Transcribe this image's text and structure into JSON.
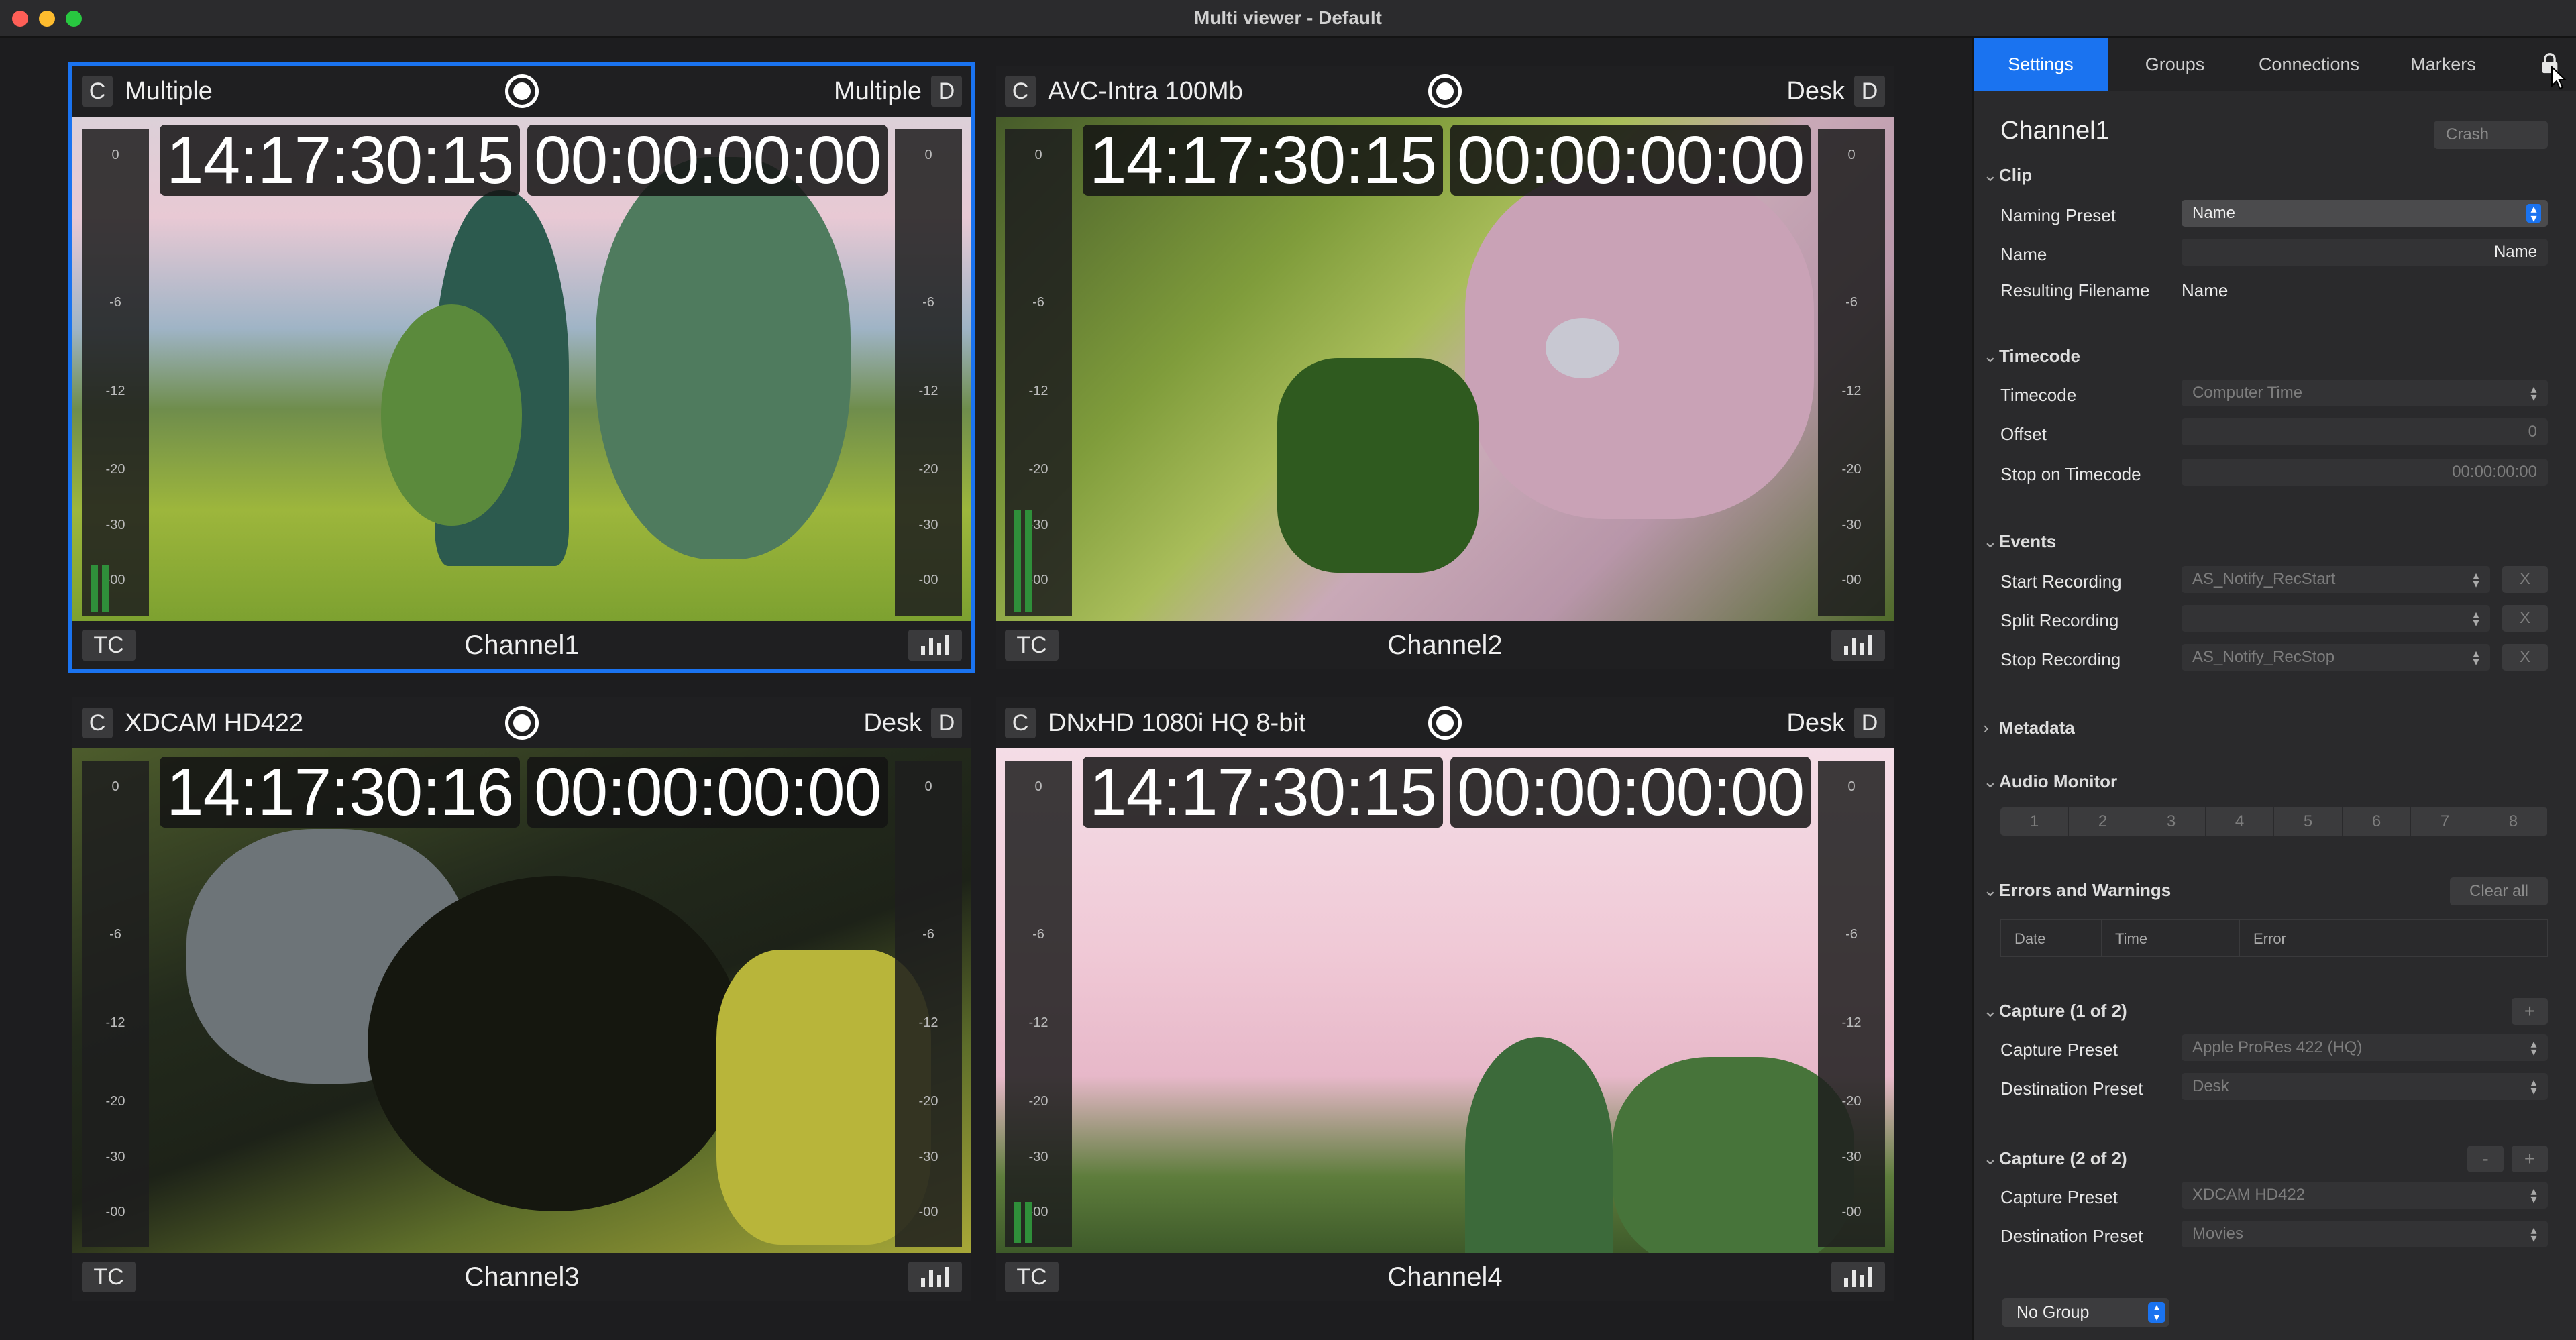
{
  "window": {
    "title": "Multi viewer - Default"
  },
  "tiles": [
    {
      "channel": "Channel1",
      "c_label": "C",
      "source": "Multiple",
      "dest": "Multiple",
      "d_label": "D",
      "tc_label": "TC",
      "time": "14:17:30:15",
      "timecode": "00:00:00:00",
      "selected": true
    },
    {
      "channel": "Channel2",
      "c_label": "C",
      "source": "AVC-Intra 100Mb",
      "dest": "Desk",
      "d_label": "D",
      "tc_label": "TC",
      "time": "14:17:30:15",
      "timecode": "00:00:00:00",
      "selected": false
    },
    {
      "channel": "Channel3",
      "c_label": "C",
      "source": "XDCAM HD422",
      "dest": "Desk",
      "d_label": "D",
      "tc_label": "TC",
      "time": "14:17:30:16",
      "timecode": "00:00:00:00",
      "selected": false
    },
    {
      "channel": "Channel4",
      "c_label": "C",
      "source": "DNxHD 1080i HQ 8-bit",
      "dest": "Desk",
      "d_label": "D",
      "tc_label": "TC",
      "time": "14:17:30:15",
      "timecode": "00:00:00:00",
      "selected": false
    }
  ],
  "meter_scale": [
    "0",
    "-6",
    "-12",
    "-20",
    "-30",
    "-00"
  ],
  "panel": {
    "tabs": [
      "Settings",
      "Groups",
      "Connections",
      "Markers"
    ],
    "active_tab": "Settings",
    "channel_title": "Channel1",
    "crash": "Crash",
    "clip": {
      "section": "Clip",
      "naming_preset_label": "Naming Preset",
      "naming_preset_value": "Name",
      "name_label": "Name",
      "name_value": "Name",
      "resulting_label": "Resulting Filename",
      "resulting_value": "Name"
    },
    "timecode": {
      "section": "Timecode",
      "timecode_label": "Timecode",
      "timecode_value": "Computer Time",
      "offset_label": "Offset",
      "offset_value": "0",
      "stop_label": "Stop on Timecode",
      "stop_value": "00:00:00:00"
    },
    "events": {
      "section": "Events",
      "start_label": "Start Recording",
      "start_value": "AS_Notify_RecStart",
      "split_label": "Split Recording",
      "split_value": "",
      "stop_label": "Stop Recording",
      "stop_value": "AS_Notify_RecStop",
      "clear": "X"
    },
    "metadata": {
      "section": "Metadata"
    },
    "audio": {
      "section": "Audio Monitor",
      "channels": [
        "1",
        "2",
        "3",
        "4",
        "5",
        "6",
        "7",
        "8"
      ]
    },
    "errors": {
      "section": "Errors and Warnings",
      "clear_all": "Clear all",
      "col_date": "Date",
      "col_time": "Time",
      "col_error": "Error"
    },
    "capture1": {
      "section": "Capture (1 of 2)",
      "capture_label": "Capture Preset",
      "capture_value": "Apple ProRes 422 (HQ)",
      "dest_label": "Destination Preset",
      "dest_value": "Desk",
      "add": "+"
    },
    "capture2": {
      "section": "Capture (2 of 2)",
      "capture_label": "Capture Preset",
      "capture_value": "XDCAM HD422",
      "dest_label": "Destination Preset",
      "dest_value": "Movies",
      "remove": "-",
      "add": "+"
    },
    "group": "No Group"
  },
  "colors": {
    "accent": "#1a73f0",
    "meter_green": "#2f8f3a"
  }
}
